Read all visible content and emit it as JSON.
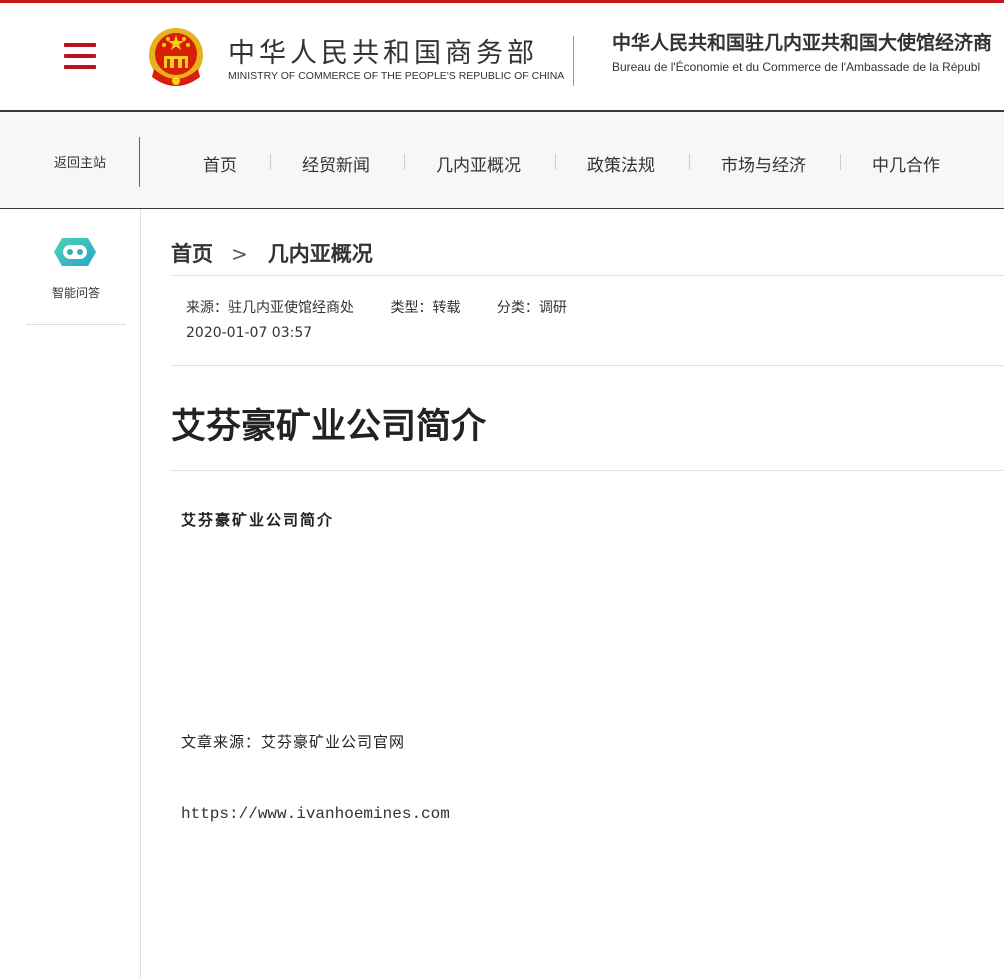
{
  "header": {
    "ministry_cn": "中华人民共和国商务部",
    "ministry_en": "MINISTRY OF COMMERCE OF THE PEOPLE'S REPUBLIC OF CHINA",
    "embassy_cn": "中华人民共和国驻几内亚共和国大使馆经济商",
    "embassy_fr": "Bureau de l'Économie et du Commerce de l'Ambassade de la Républ"
  },
  "nav": {
    "back_home": "返回主站",
    "items": [
      "首页",
      "经贸新闻",
      "几内亚概况",
      "政策法规",
      "市场与经济",
      "中几合作"
    ]
  },
  "sidebar": {
    "ai_label": "智能问答"
  },
  "breadcrumb": {
    "home": "首页",
    "section": "几内亚概况"
  },
  "article": {
    "source": "来源：驻几内亚使馆经商处",
    "type": "类型：转载",
    "category": "分类：调研",
    "date": "2020-01-07 03:57",
    "title": "艾芬豪矿业公司简介",
    "body_heading": "艾芬豪矿业公司简介",
    "body_source": "文章来源：艾芬豪矿业公司官网",
    "body_url": "https://www.ivanhoemines.com"
  },
  "colors": {
    "brand_red": "#c8161d",
    "ai_icon": "#3ec6b0"
  }
}
